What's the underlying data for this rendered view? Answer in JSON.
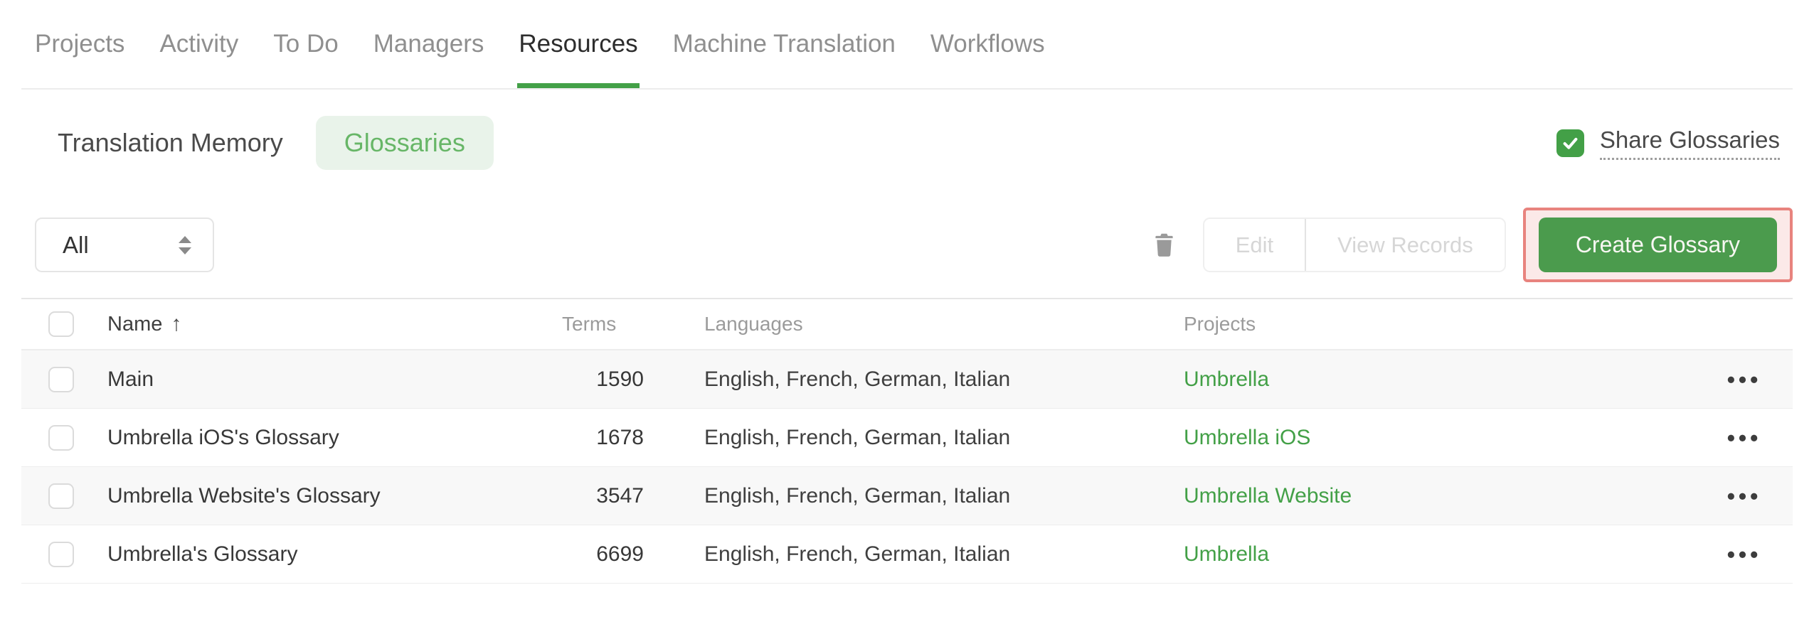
{
  "colors": {
    "accent_green": "#43A047",
    "button_green": "#4B9B4D",
    "pill_bg": "#E9F3EA",
    "pill_text": "#67B667",
    "link_green": "#43A047",
    "annotation_red": "#E8837E",
    "annotation_bg": "#FBE9E8",
    "row_stripe": "#F8F8F8"
  },
  "nav": {
    "tabs": [
      {
        "label": "Projects",
        "active": false
      },
      {
        "label": "Activity",
        "active": false
      },
      {
        "label": "To Do",
        "active": false
      },
      {
        "label": "Managers",
        "active": false
      },
      {
        "label": "Resources",
        "active": true
      },
      {
        "label": "Machine Translation",
        "active": false
      },
      {
        "label": "Workflows",
        "active": false
      }
    ]
  },
  "subtabs": {
    "translation_memory": "Translation Memory",
    "glossaries": "Glossaries"
  },
  "share": {
    "label": "Share Glossaries",
    "checked": true
  },
  "toolbar": {
    "filter_value": "All",
    "edit_label": "Edit",
    "view_records_label": "View Records",
    "create_label": "Create Glossary"
  },
  "icons": {
    "trash": "trash-can",
    "select_caret": "up-down-carets",
    "sort_ascending": "↑",
    "row_menu": "•••",
    "checkmark": "check"
  },
  "table": {
    "headers": {
      "name": "Name",
      "terms": "Terms",
      "languages": "Languages",
      "projects": "Projects"
    },
    "rows": [
      {
        "name": "Main",
        "terms": "1590",
        "languages": "English, French, German, Italian",
        "project": "Umbrella"
      },
      {
        "name": "Umbrella iOS's Glossary",
        "terms": "1678",
        "languages": "English, French, German, Italian",
        "project": "Umbrella iOS"
      },
      {
        "name": "Umbrella Website's Glossary",
        "terms": "3547",
        "languages": "English, French, German, Italian",
        "project": "Umbrella Website"
      },
      {
        "name": "Umbrella's Glossary",
        "terms": "6699",
        "languages": "English, French, German, Italian",
        "project": "Umbrella"
      }
    ]
  }
}
